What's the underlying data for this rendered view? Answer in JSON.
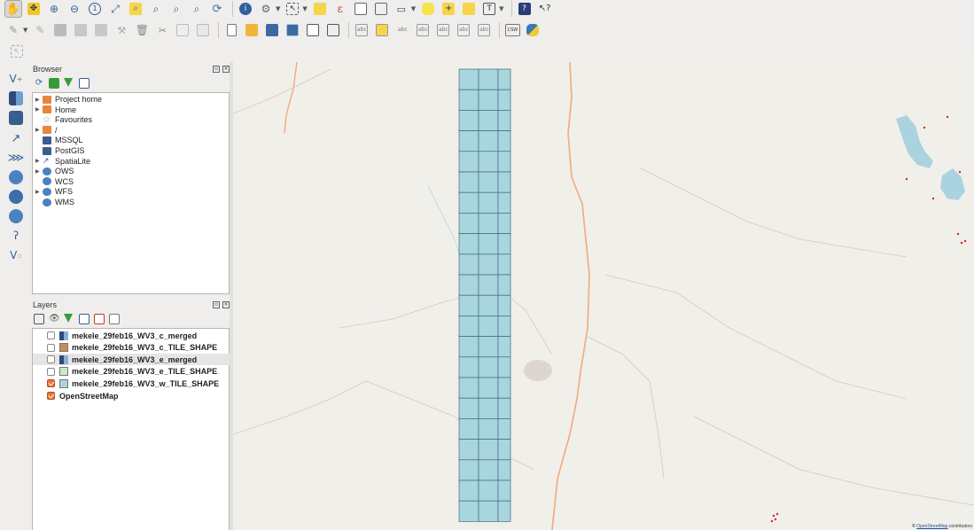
{
  "toolbar_top": {
    "icons": [
      "pan-map-icon",
      "pan-to-selection-icon",
      "zoom-in-icon",
      "zoom-out-icon",
      "zoom-native-icon",
      "zoom-full-icon",
      "zoom-to-selection-icon",
      "zoom-to-layer-icon",
      "zoom-last-icon",
      "zoom-next-icon",
      "refresh-icon",
      "identify-icon",
      "measure-icon",
      "select-features-icon",
      "deselect-icon",
      "expression-select-icon",
      "attribute-table-icon",
      "statistics-icon",
      "measure-line-icon",
      "map-tips-icon",
      "new-bookmark-icon",
      "show-bookmarks-icon",
      "text-annotation-icon",
      "help-icon",
      "whats-this-icon"
    ]
  },
  "toolbar_second": {
    "csw_label": "CSW"
  },
  "browser": {
    "title": "Browser",
    "items": [
      {
        "label": "Project home",
        "expandable": true,
        "icon": "folder-icon"
      },
      {
        "label": "Home",
        "expandable": true,
        "icon": "folder-icon"
      },
      {
        "label": "Favourites",
        "expandable": false,
        "icon": "star-icon"
      },
      {
        "label": "/",
        "expandable": true,
        "icon": "folder-icon"
      },
      {
        "label": "MSSQL",
        "expandable": false,
        "icon": "mssql-icon"
      },
      {
        "label": "PostGIS",
        "expandable": false,
        "icon": "postgis-icon"
      },
      {
        "label": "SpatiaLite",
        "expandable": true,
        "icon": "spatialite-icon"
      },
      {
        "label": "OWS",
        "expandable": true,
        "icon": "globe-icon"
      },
      {
        "label": "WCS",
        "expandable": false,
        "icon": "globe-icon"
      },
      {
        "label": "WFS",
        "expandable": true,
        "icon": "globe-icon"
      },
      {
        "label": "WMS",
        "expandable": false,
        "icon": "globe-icon"
      }
    ]
  },
  "layers": {
    "title": "Layers",
    "items": [
      {
        "label": "mekele_29feb16_WV3_c_merged",
        "checked": false,
        "symbol": "raster",
        "selected": false
      },
      {
        "label": "mekele_29feb16_WV3_c_TILE_SHAPE",
        "checked": false,
        "symbol": "#c98b5a",
        "selected": false
      },
      {
        "label": "mekele_29feb16_WV3_e_merged",
        "checked": false,
        "symbol": "raster",
        "selected": true
      },
      {
        "label": "mekele_29feb16_WV3_e_TILE_SHAPE",
        "checked": false,
        "symbol": "#cfe8c8",
        "selected": false
      },
      {
        "label": "mekele_29feb16_WV3_w_TILE_SHAPE",
        "checked": true,
        "symbol": "#a9d5de",
        "selected": false
      },
      {
        "label": "OpenStreetMap",
        "checked": true,
        "symbol": "osm",
        "selected": false,
        "top_level": true
      }
    ]
  },
  "map": {
    "tile_fill": "#a9d5de",
    "tile_stroke": "#3d6b7a",
    "attribution_prefix": "©",
    "attribution_link": "OpenStreetMap",
    "attribution_suffix": "contributors"
  }
}
